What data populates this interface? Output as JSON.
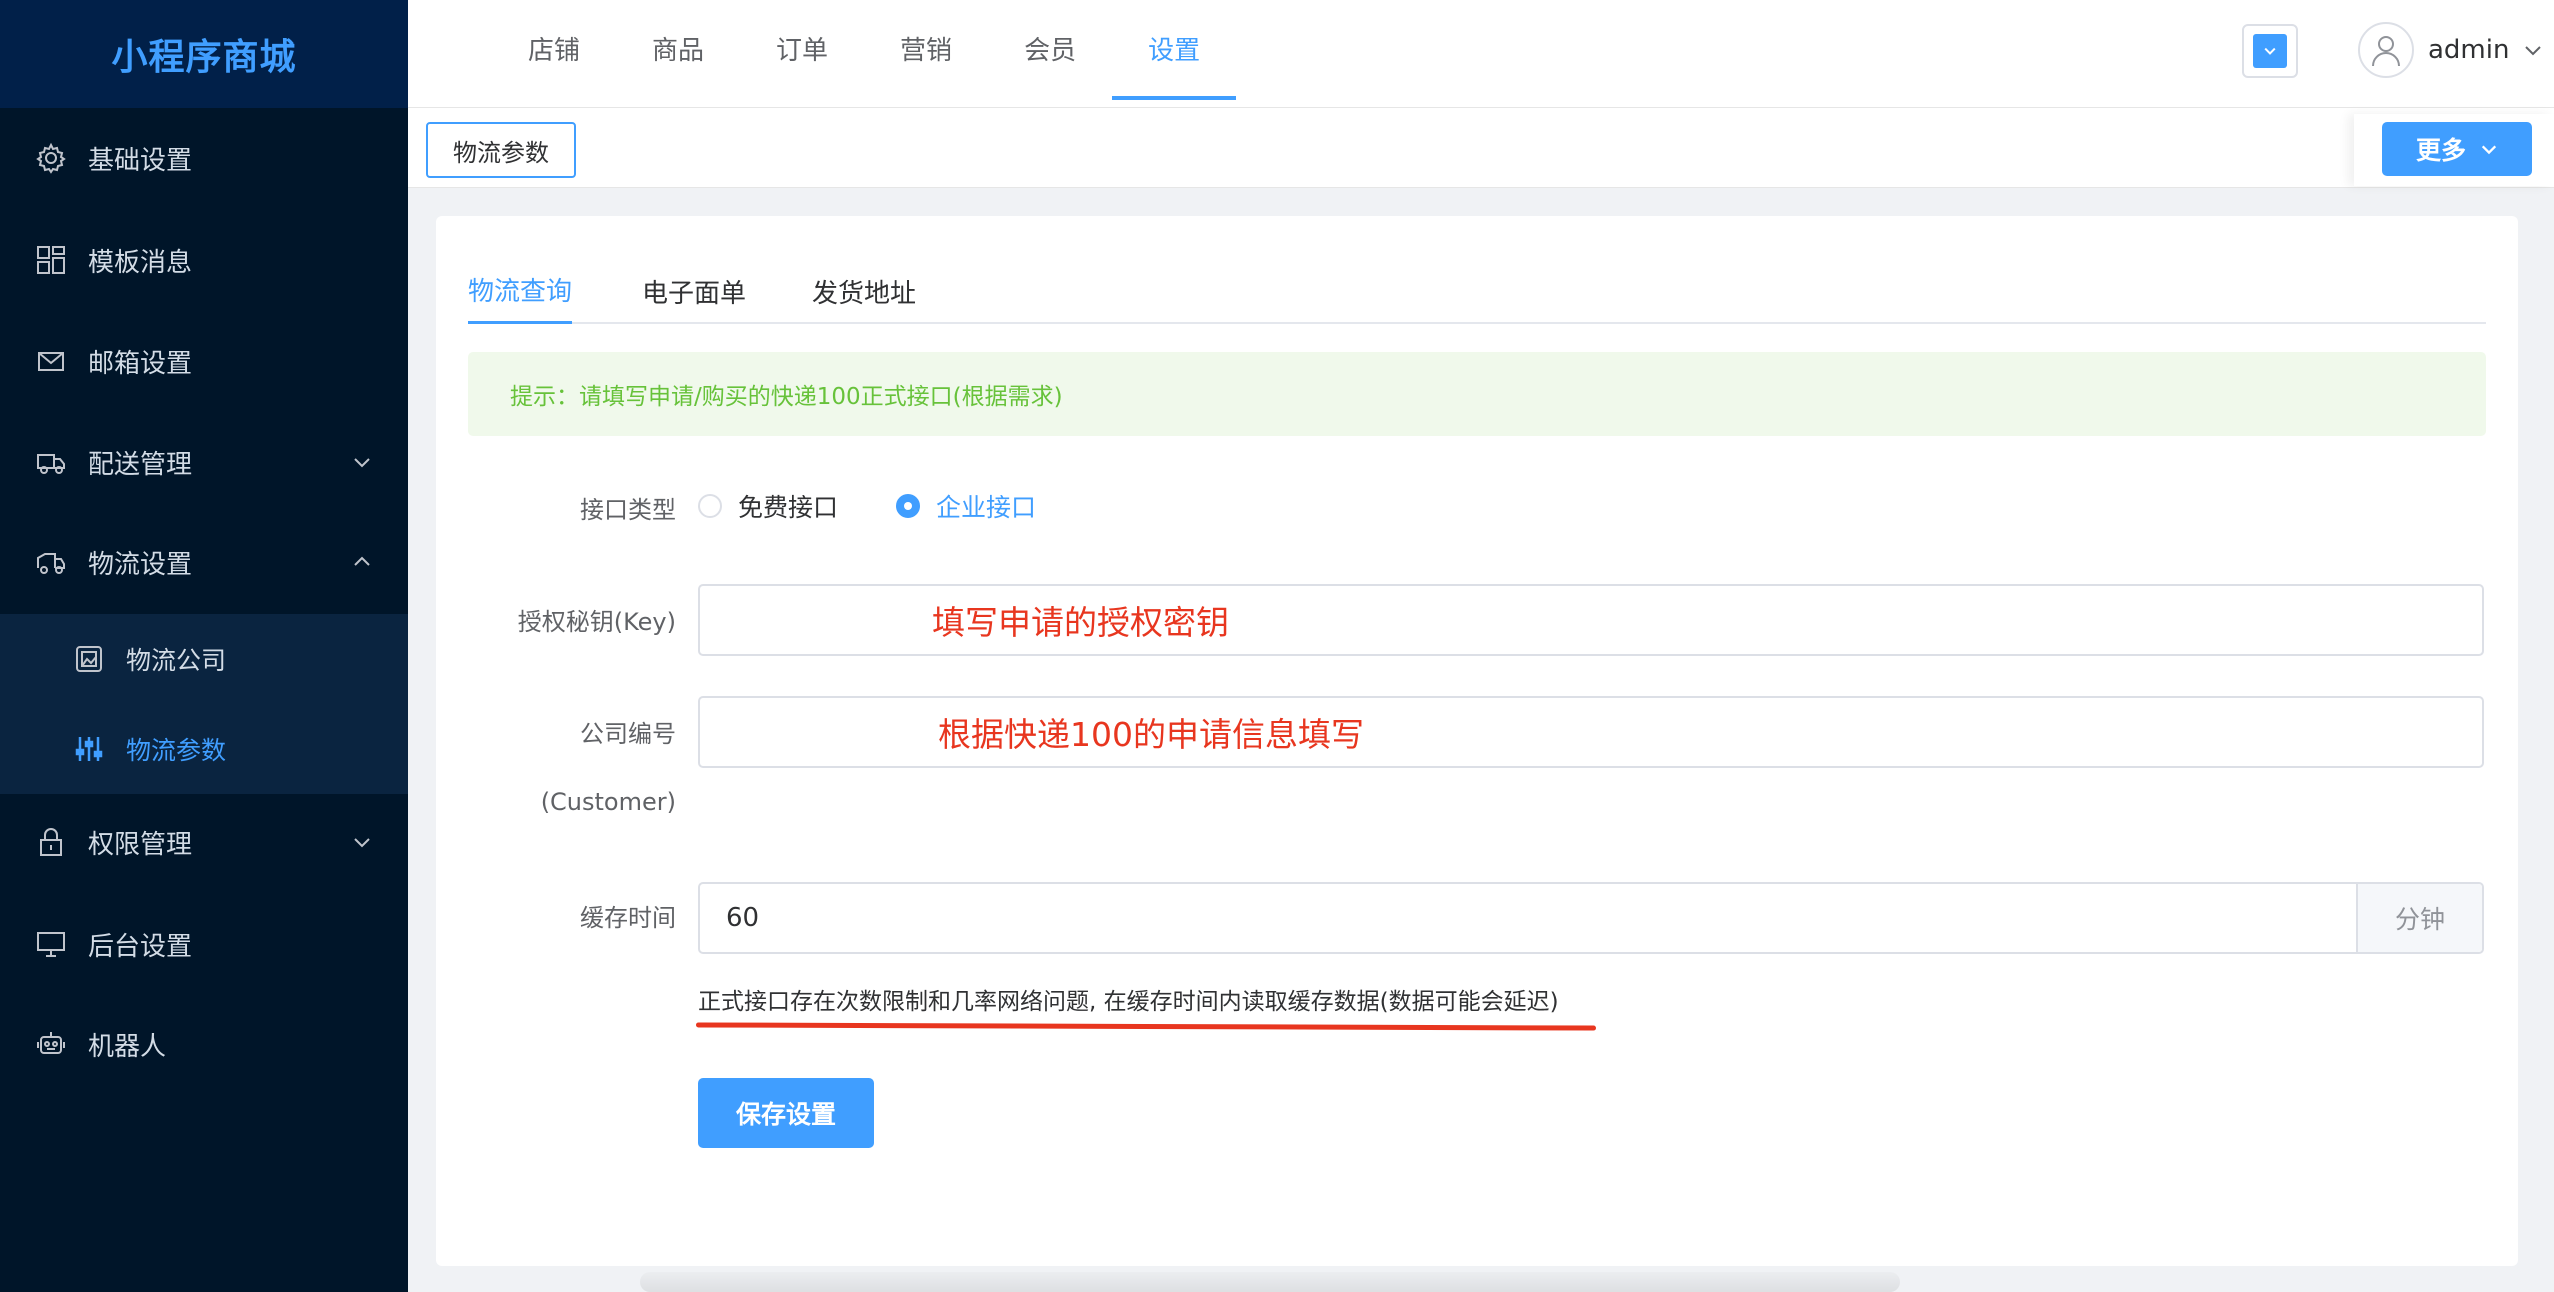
{
  "app": {
    "brand": "小程序商城"
  },
  "sidebar": {
    "items": [
      {
        "label": "基础设置",
        "icon": "gear-icon"
      },
      {
        "label": "模板消息",
        "icon": "grid-icon"
      },
      {
        "label": "邮箱设置",
        "icon": "mail-icon"
      },
      {
        "label": "配送管理",
        "icon": "truck-icon",
        "arrow": "chevron-down"
      },
      {
        "label": "物流设置",
        "icon": "delivery-icon",
        "arrow": "chevron-up"
      },
      {
        "label": "权限管理",
        "icon": "lock-icon",
        "arrow": "chevron-down"
      },
      {
        "label": "后台设置",
        "icon": "monitor-icon"
      },
      {
        "label": "机器人",
        "icon": "robot-icon"
      }
    ],
    "sub_items": [
      {
        "label": "物流公司",
        "icon": "picture-icon"
      },
      {
        "label": "物流参数",
        "icon": "sliders-icon",
        "active": true
      }
    ]
  },
  "header": {
    "nav": [
      "店铺",
      "商品",
      "订单",
      "营销",
      "会员",
      "设置"
    ],
    "active_nav": "设置",
    "user": "admin"
  },
  "tagbar": {
    "tag": "物流参数",
    "more": "更多"
  },
  "tabs": [
    "物流查询",
    "电子面单",
    "发货地址"
  ],
  "alert": "提示：请填写申请/购买的快递100正式接口(根据需求)",
  "form": {
    "api_type_label": "接口类型",
    "api_options": [
      "免费接口",
      "企业接口"
    ],
    "api_selected": "企业接口",
    "key_label": "授权秘钥(Key)",
    "key_hint": "填写申请的授权密钥",
    "customer_label_1": "公司编号",
    "customer_label_2": "(Customer)",
    "customer_hint": "根据快递100的申请信息填写",
    "cache_label": "缓存时间",
    "cache_value": "60",
    "cache_unit": "分钟",
    "note": "正式接口存在次数限制和几率网络问题, 在缓存时间内读取缓存数据(数据可能会延迟)",
    "save": "保存设置"
  },
  "colors": {
    "primary": "#409eff",
    "sidebar": "#001529",
    "annotation": "#e8361f",
    "success": "#67c23a"
  }
}
